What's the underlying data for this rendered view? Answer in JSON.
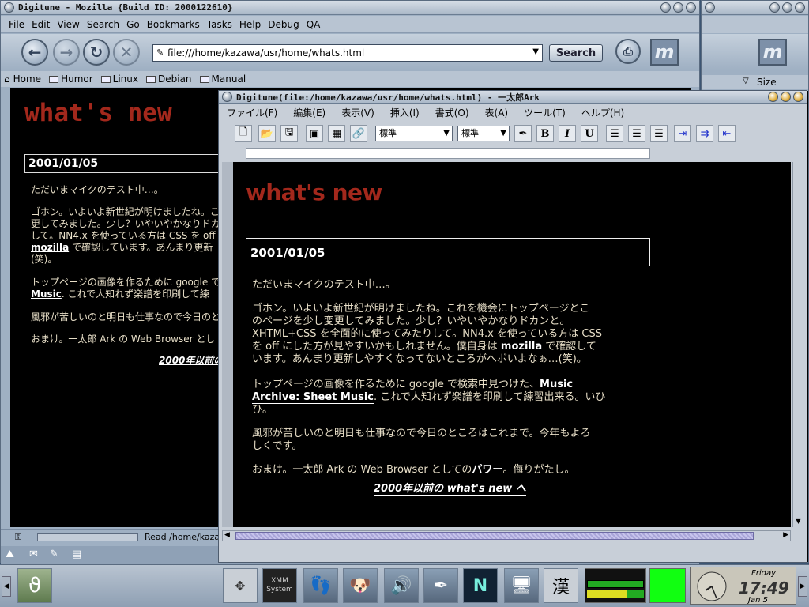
{
  "mozilla": {
    "title": "Digitune - Mozilla {Build ID: 2000122610}",
    "menu": [
      "File",
      "Edit",
      "View",
      "Search",
      "Go",
      "Bookmarks",
      "Tasks",
      "Help",
      "Debug",
      "QA"
    ],
    "url": "file:///home/kazawa/usr/home/whats.html",
    "search_label": "Search",
    "bookmarks": [
      "Home",
      "Humor",
      "Linux",
      "Debian",
      "Manual"
    ],
    "content": {
      "heading": "what's new",
      "date": "2001/01/05",
      "p1": "ただいまマイクのテスト中…。",
      "p2_l1": "ゴホン。いよいよ新世紀が明けましたね。こ",
      "p2_l2": "更してみました。少し？いやいやかなりドカ",
      "p2_l3": "して。NN4.x を使っている方は CSS を off",
      "p2_l4_link": "mozilla",
      "p2_l4": " で確認しています。あんまり更新",
      "p2_l5": "(笑)。",
      "p3_l1": "トップページの画像を作るために google で",
      "p3_l2_link": "Music",
      "p3_l2": ". これで人知れず楽譜を印刷して練",
      "p4": "風邪が苦しいのと明日も仕事なので今日のと",
      "p5": "おまけ。一太郎 Ark の Web Browser とし",
      "link": "2000年以前の"
    },
    "status": "Read /home/kazawa/",
    "sidebar_size_label": "Size"
  },
  "ark": {
    "title": "Digitune(file:/home/kazawa/usr/home/whats.html) - 一太郎Ark",
    "menu": [
      "ファイル(F)",
      "編集(E)",
      "表示(V)",
      "挿入(I)",
      "書式(O)",
      "表(A)",
      "ツール(T)",
      "ヘルプ(H)"
    ],
    "style_combo": "標準",
    "font_combo": "標準",
    "bold": "B",
    "italic": "I",
    "underline": "U",
    "doc": {
      "heading": "what's new",
      "date": "2001/01/05",
      "p1": "ただいまマイクのテスト中…。",
      "p2_l1": "ゴホン。いよいよ新世紀が明けましたね。これを機会にトップページとこ",
      "p2_l2": "のページを少し変更してみました。少し？いやいやかなりドカンと。",
      "p2_l3": "XHTML+CSS を全面的に使ってみたりして。NN4.x を使っている方は CSS",
      "p2_l4a": "を off にした方が見やすいかもしれません。僕自身は ",
      "p2_l4_link": "mozilla",
      "p2_l4b": " で確認して",
      "p2_l5": "います。あんまり更新しやすくなってないところがへボいよなぁ…(笑)。",
      "p3_l1a": "トップページの画像を作るために google で検索中見つけた、",
      "p3_l1_link": "Music",
      "p3_l2_link": "Archive: Sheet Music",
      "p3_l2b": ". これで人知れず楽譜を印刷して練習出来る。いひ",
      "p3_l3": "ひ。",
      "p4_l1": "風邪が苦しいのと明日も仕事なので今日のところはこれまで。今年もよろ",
      "p4_l2": "しくです。",
      "p5a": "おまけ。一太郎 Ark の Web Browser としての",
      "p5_power": "パワー",
      "p5b": "。侮りがたし。",
      "link": "2000年以前の what's new へ"
    }
  },
  "panel": {
    "day": "Friday",
    "time": "17:49",
    "date": "Jan 5",
    "kanji": "漢",
    "xmms_line1": "XMM",
    "xmms_line2": "System"
  }
}
